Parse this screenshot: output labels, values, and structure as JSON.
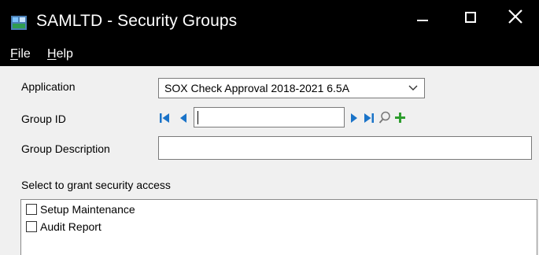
{
  "window": {
    "title": "SAMLTD - Security Groups",
    "icon": "app-icon",
    "controls": [
      "minimize-icon",
      "maximize-icon",
      "close-icon"
    ]
  },
  "menu": {
    "items": [
      {
        "label": "File",
        "accelerator": "F"
      },
      {
        "label": "Help",
        "accelerator": "H"
      }
    ]
  },
  "form": {
    "application_label": "Application",
    "application_value": "SOX Check Approval 2018-2021 6.5A",
    "group_id_label": "Group ID",
    "group_id_value": "",
    "group_description_label": "Group Description",
    "group_description_value": "",
    "nav_icons": [
      "first-record-icon",
      "previous-record-icon",
      "next-record-icon",
      "last-record-icon",
      "finder-icon",
      "new-record-icon"
    ],
    "new_icon_color": "#2e9d2e",
    "nav_icon_color": "#1a73c8"
  },
  "access": {
    "heading": "Select to grant security access",
    "items": [
      {
        "label": "Setup Maintenance",
        "checked": false
      },
      {
        "label": "Audit Report",
        "checked": false
      }
    ]
  }
}
